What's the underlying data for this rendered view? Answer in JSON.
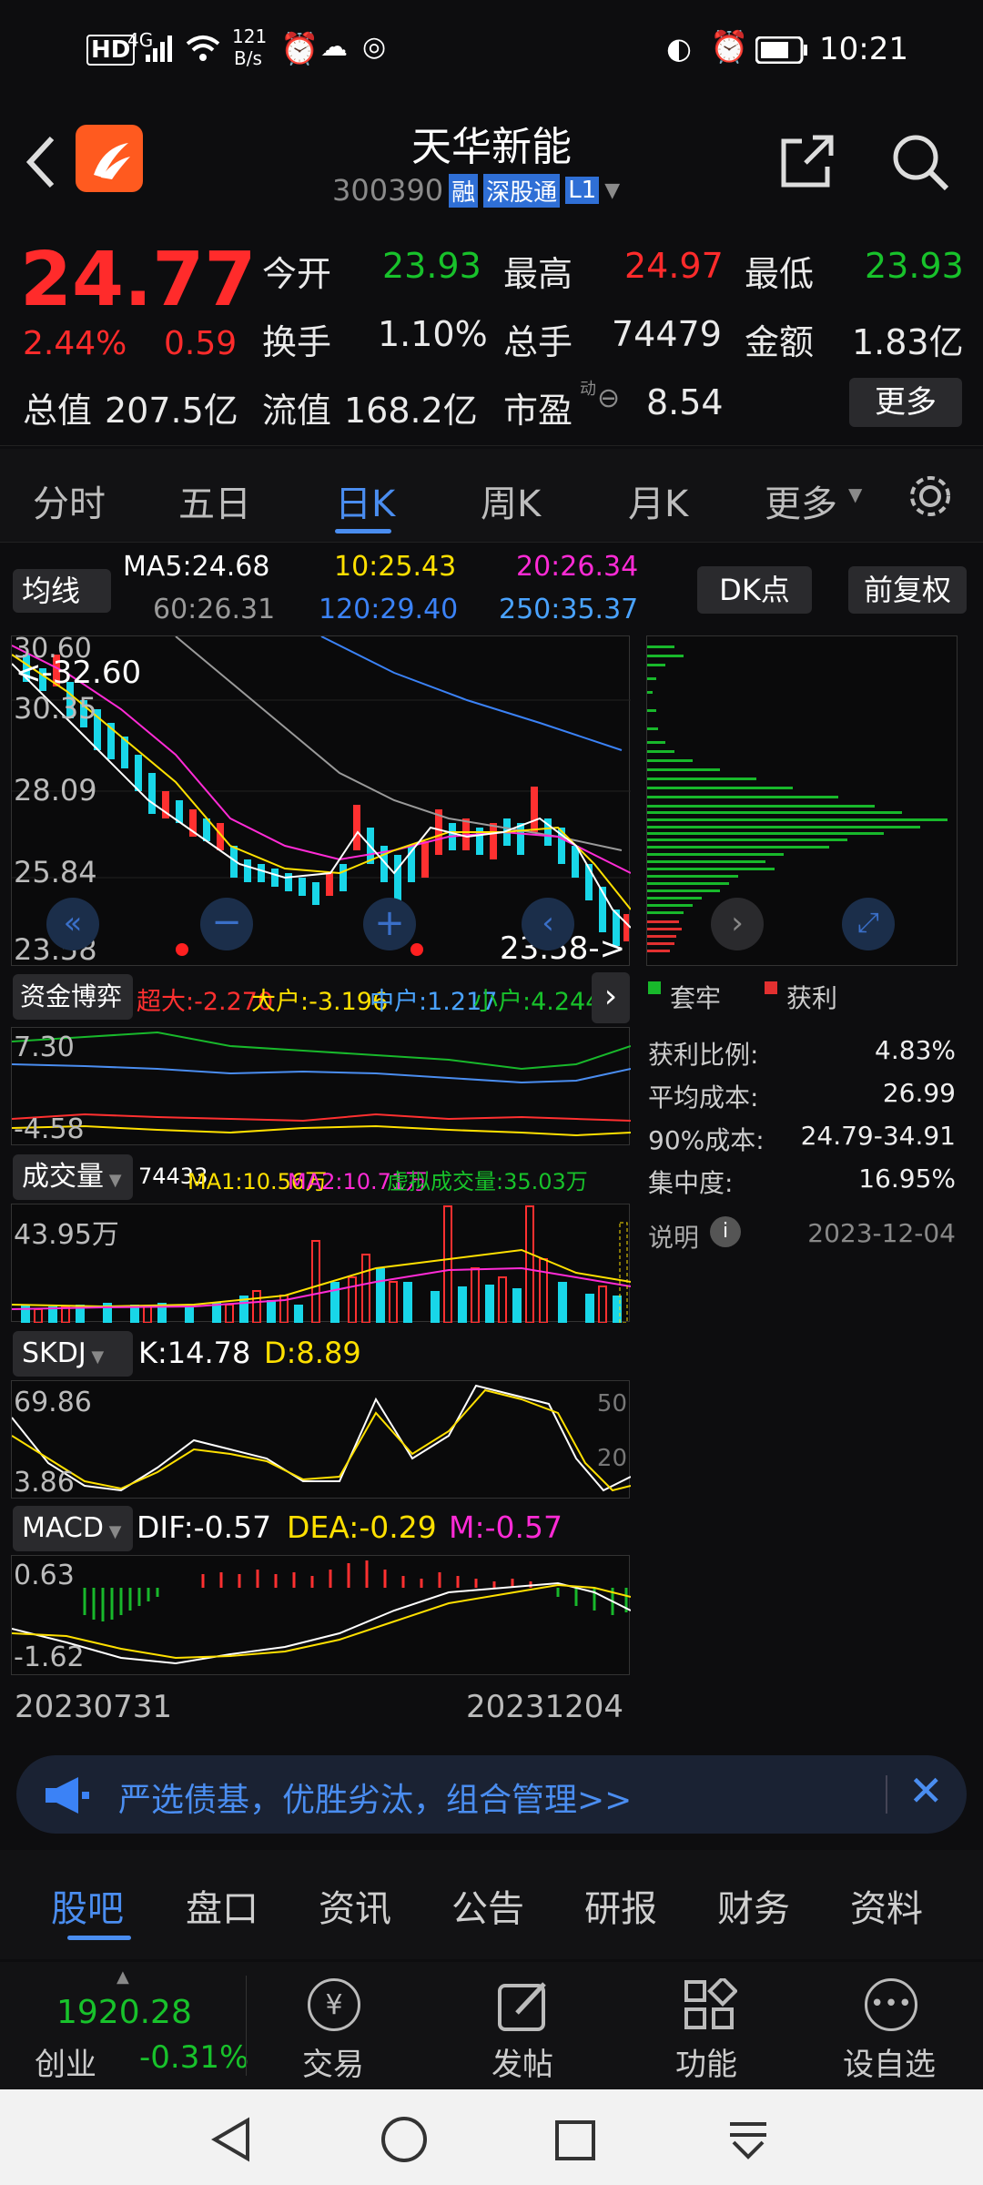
{
  "status": {
    "hd": "HD",
    "net": "4G",
    "speed_top": "121",
    "speed_bot": "B/s",
    "time": "10:21"
  },
  "header": {
    "title": "天华新能",
    "code": "300390",
    "badge_rong": "融",
    "badge_sgt": "深股通",
    "badge_l1": "L1"
  },
  "quote": {
    "price": "24.77",
    "change_pct": "2.44%",
    "change": "0.59",
    "open_label": "今开",
    "open": "23.93",
    "high_label": "最高",
    "high": "24.97",
    "low_label": "最低",
    "low": "23.93",
    "turnover_label": "换手",
    "turnover": "1.10%",
    "volume_label": "总手",
    "volume": "74479",
    "amount_label": "金额",
    "amount": "1.83亿",
    "mktcap_label": "总值",
    "mktcap": "207.5亿",
    "float_label": "流值",
    "float": "168.2亿",
    "pe_label": "市盈",
    "pe_sup": "动",
    "pe": "8.54",
    "more": "更多"
  },
  "tabs": [
    "分时",
    "五日",
    "日K",
    "周K",
    "月K",
    "更多"
  ],
  "ma_bar": {
    "btn": "均线",
    "ma5": "MA5:24.68",
    "ma10": "10:25.43",
    "ma20": "20:26.34",
    "ma60": "60:26.31",
    "ma120": "120:29.40",
    "ma250": "250:35.37",
    "dk": "DK点",
    "fq": "前复权"
  },
  "kline": {
    "y_labels": [
      "30.35",
      "28.09",
      "25.84",
      "23.58"
    ],
    "top_label": "30.60",
    "max_mark": "<-32.60",
    "min_mark": "23.58->"
  },
  "capital": {
    "btn": "资金博弈",
    "cd": "超大:-2.270",
    "dh": "大户:-3.196",
    "zh": "中户:1.217",
    "xh": "小户:4.244",
    "y_top": "7.30",
    "y_bot": "-4.58"
  },
  "volume": {
    "btn": "成交量",
    "v": "74433",
    "ma1": "MA1:10.56万",
    "ma2": "MA2:10.71万",
    "virt": "虚拟成交量:35.03万",
    "y_top": "43.95万"
  },
  "skdj": {
    "btn": "SKDJ",
    "k": "K:14.78",
    "d": "D:8.89",
    "y_top": "69.86",
    "y_bot": "3.86",
    "lvl50": "50",
    "lvl20": "20"
  },
  "macd": {
    "btn": "MACD",
    "dif": "DIF:-0.57",
    "dea": "DEA:-0.29",
    "m": "M:-0.57",
    "y_top": "0.63",
    "y_bot": "-1.62"
  },
  "dates": {
    "start": "20230731",
    "end": "20231204"
  },
  "chip": {
    "legend_trap": "套牢",
    "legend_profit": "获利",
    "profit_ratio_label": "获利比例:",
    "profit_ratio": "4.83%",
    "avg_cost_label": "平均成本:",
    "avg_cost": "26.99",
    "cost90_label": "90%成本:",
    "cost90": "24.79-34.91",
    "conc_label": "集中度:",
    "conc": "16.95%",
    "note": "说明",
    "date": "2023-12-04"
  },
  "banner": {
    "text": "严选债基，优胜劣汰，组合管理>>"
  },
  "bottom_tabs": [
    "股吧",
    "盘口",
    "资讯",
    "公告",
    "研报",
    "财务",
    "资料"
  ],
  "index": {
    "value": "1920.28",
    "name": "创业",
    "pct": "-0.31%"
  },
  "actions": [
    "交易",
    "发帖",
    "功能",
    "设自选"
  ],
  "colors": {
    "up": "#ff2b2b",
    "down": "#18c22b",
    "accent": "#4a8df0",
    "ma5": "#ffffff",
    "ma10": "#ffe000",
    "ma20": "#ff2bd6",
    "ma60": "#9a9a9a",
    "ma120": "#3b82f6"
  }
}
